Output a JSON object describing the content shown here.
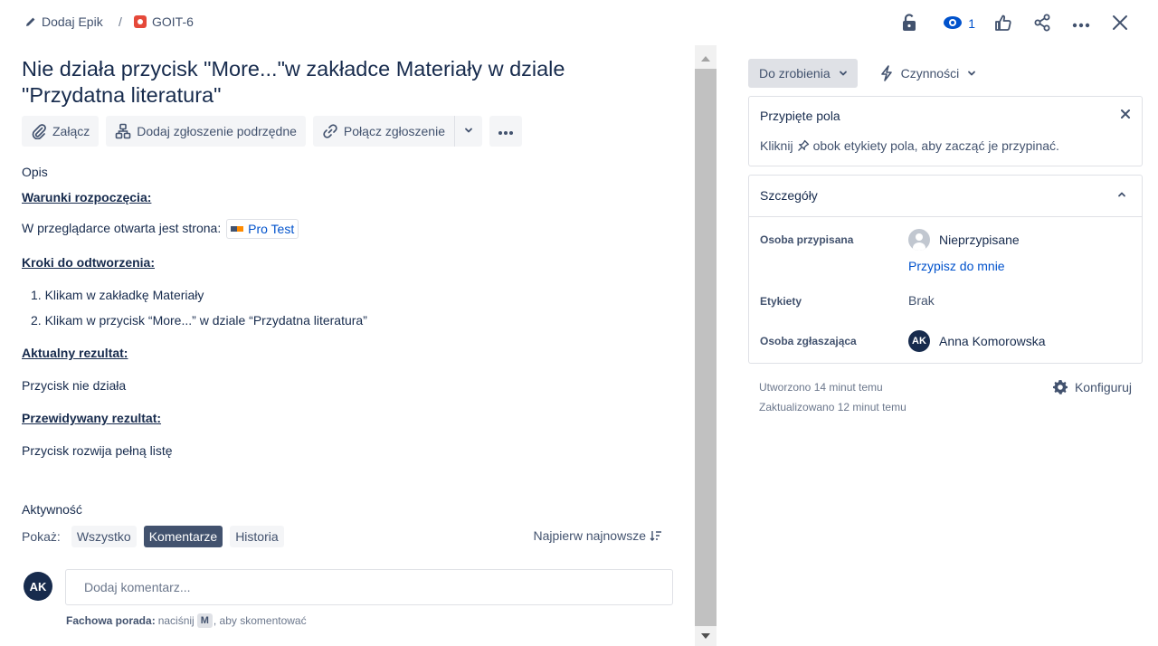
{
  "breadcrumb": {
    "epic_label": "Dodaj Epik",
    "separator": "/",
    "issue_key": "GOIT-6"
  },
  "top_actions": {
    "watchers_count": "1"
  },
  "issue": {
    "title": "Nie działa przycisk \"More...\"w zakładce Materiały w dziale \"Przydatna literatura\""
  },
  "toolbar": {
    "attach_label": "Załącz",
    "add_child_label": "Dodaj zgłoszenie podrzędne",
    "link_issue_label": "Połącz zgłoszenie"
  },
  "description": {
    "label": "Opis",
    "preconditions_heading": "Warunki rozpoczęcia:",
    "preconditions_text": "W przeglądarce otwarta jest strona:",
    "page_link": "Pro Test",
    "steps_heading": "Kroki do odtworzenia:",
    "steps": [
      "1. Klikam w zakładkę Materiały",
      "2. Klikam w przycisk “More...”  w dziale “Przydatna literatura”"
    ],
    "actual_heading": "Aktualny rezultat:",
    "actual_text": "Przycisk nie działa",
    "expected_heading": "Przewidywany rezultat:",
    "expected_text": "Przycisk rozwija pełną listę"
  },
  "activity": {
    "label": "Aktywność",
    "show_label": "Pokaż:",
    "filters": [
      "Wszystko",
      "Komentarze",
      "Historia"
    ],
    "active_filter": "Komentarze",
    "sort_label": "Najpierw najnowsze",
    "user_initials": "AK",
    "comment_placeholder": "Dodaj komentarz...",
    "tip_bold": "Fachowa porada:",
    "tip_text_before": "naciśnij",
    "tip_key": "M",
    "tip_text_after": ", aby skomentować"
  },
  "sidebar": {
    "status_label": "Do zrobienia",
    "actions_label": "Czynności",
    "pinned": {
      "title": "Przypięte pola",
      "text_before": "Kliknij",
      "text_after": "obok etykiety pola, aby zacząć je przypinać."
    },
    "details": {
      "title": "Szczegóły",
      "assignee_label": "Osoba przypisana",
      "assignee_value": "Nieprzypisane",
      "assign_to_me": "Przypisz do mnie",
      "labels_label": "Etykiety",
      "labels_value": "Brak",
      "reporter_label": "Osoba zgłaszająca",
      "reporter_initials": "AK",
      "reporter_value": "Anna Komorowska"
    },
    "created": "Utworzono 14 minut temu",
    "updated": "Zaktualizowano 12 minut temu",
    "configure_label": "Konfiguruj"
  },
  "colors": {
    "accent": "#0052cc",
    "text": "#172b4d",
    "bug": "#e5493a",
    "active_filter_bg": "#42526e"
  },
  "icons": [
    "pencil-icon",
    "bug-icon",
    "lock-icon",
    "eye-icon",
    "thumbs-up-icon",
    "share-icon",
    "more-icon",
    "close-icon",
    "paperclip-icon",
    "hierarchy-icon",
    "link-icon",
    "chevron-down-icon",
    "lightning-icon",
    "pin-icon",
    "chevron-up-icon",
    "gear-icon",
    "sort-icon"
  ]
}
